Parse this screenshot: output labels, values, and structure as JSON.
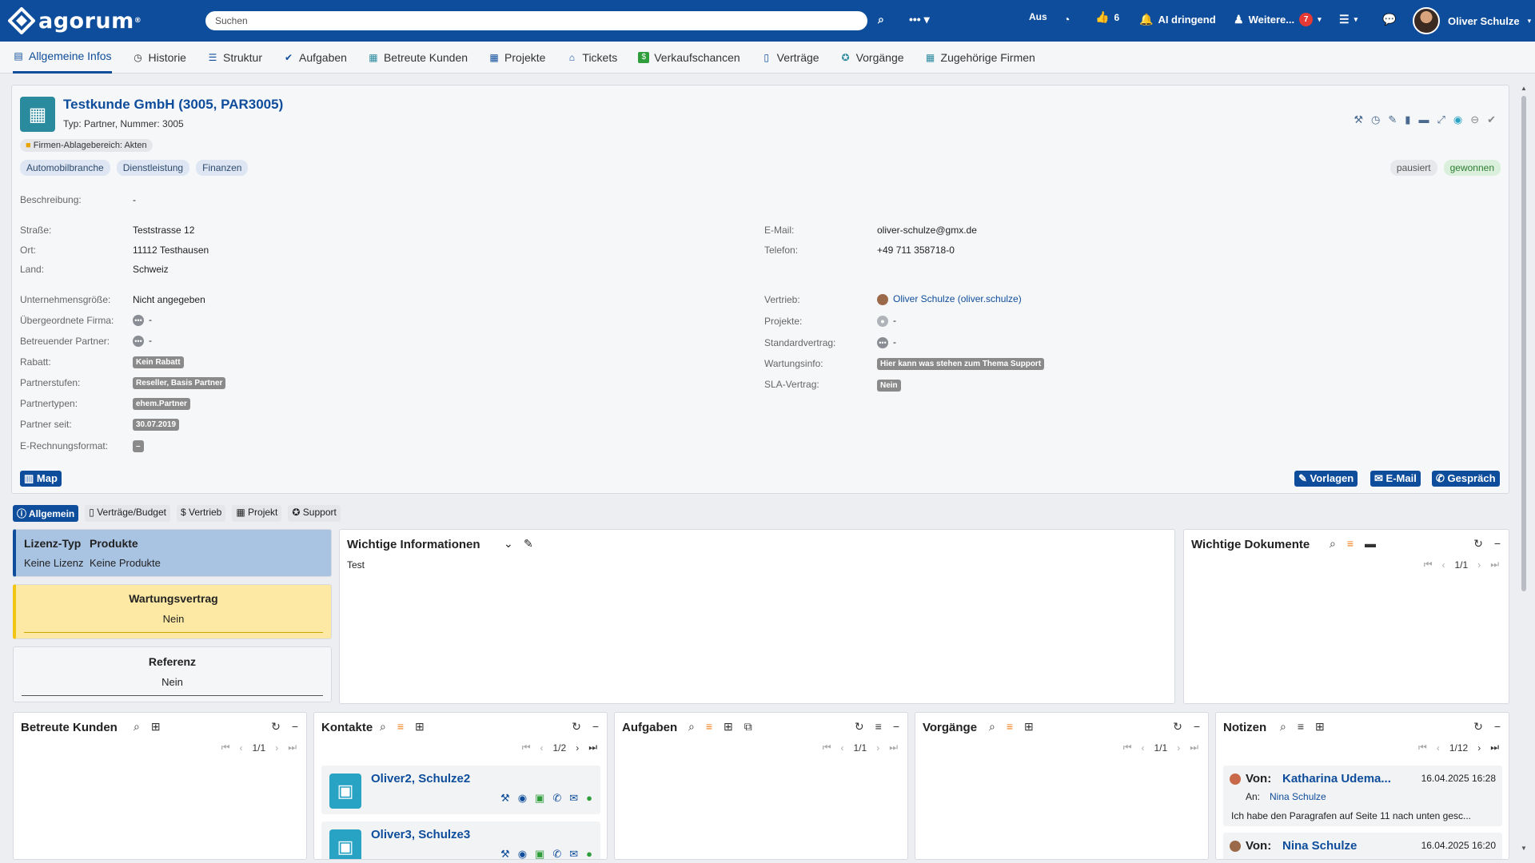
{
  "topbar": {
    "logo": "agorum",
    "search_placeholder": "Suchen",
    "aus": "Aus",
    "likes": "6",
    "ai_label": "AI dringend",
    "more_label": "Weitere...",
    "more_count": "7",
    "user_name": "Oliver Schulze"
  },
  "tabs": [
    {
      "label": "Allgemeine Infos",
      "icon": "list-icon",
      "active": true
    },
    {
      "label": "Historie",
      "icon": "clock-icon"
    },
    {
      "label": "Struktur",
      "icon": "structure-icon"
    },
    {
      "label": "Aufgaben",
      "icon": "check-icon"
    },
    {
      "label": "Betreute Kunden",
      "icon": "building-icon"
    },
    {
      "label": "Projekte",
      "icon": "grid-icon"
    },
    {
      "label": "Tickets",
      "icon": "ticket-icon"
    },
    {
      "label": "Verkaufschancen",
      "icon": "dollar-icon"
    },
    {
      "label": "Verträge",
      "icon": "document-icon"
    },
    {
      "label": "Vorgänge",
      "icon": "process-icon"
    },
    {
      "label": "Zugehörige Firmen",
      "icon": "company-icon"
    }
  ],
  "company": {
    "title": "Testkunde GmbH (3005, PAR3005)",
    "subtitle": "Typ: Partner, Nummer: 3005",
    "ablage": "Firmen-Ablagebereich: Akten",
    "tags": [
      "Automobilbranche",
      "Dienstleistung",
      "Finanzen"
    ],
    "status_paused": "pausiert",
    "status_won": "gewonnen"
  },
  "fields_left": {
    "beschreibung_label": "Beschreibung:",
    "beschreibung": "-",
    "strasse_label": "Straße:",
    "strasse": "Teststrasse 12",
    "ort_label": "Ort:",
    "ort": "11112 Testhausen",
    "land_label": "Land:",
    "land": "Schweiz",
    "groesse_label": "Unternehmensgröße:",
    "groesse": "Nicht angegeben",
    "uebergeordnet_label": "Übergeordnete Firma:",
    "uebergeordnet": "-",
    "partner_label": "Betreuender Partner:",
    "partner": "-",
    "rabatt_label": "Rabatt:",
    "rabatt": "Kein Rabatt",
    "partnerstufen_label": "Partnerstufen:",
    "partnerstufen": "Reseller, Basis Partner",
    "partnertypen_label": "Partnertypen:",
    "partnertypen": "ehem.Partner",
    "partner_seit_label": "Partner seit:",
    "partner_seit": "30.07.2019",
    "erechnung_label": "E-Rechnungsformat:",
    "erechnung": "–"
  },
  "fields_right": {
    "email_label": "E-Mail:",
    "email": "oliver-schulze@gmx.de",
    "telefon_label": "Telefon:",
    "telefon": "+49 711 358718-0",
    "vertrieb_label": "Vertrieb:",
    "vertrieb": "Oliver Schulze (oliver.schulze)",
    "projekte_label": "Projekte:",
    "projekte": "-",
    "standard_label": "Standardvertrag:",
    "standard": "-",
    "wartung_label": "Wartungsinfo:",
    "wartung": "Hier kann was stehen zum Thema Support",
    "sla_label": "SLA-Vertrag:",
    "sla": "Nein"
  },
  "buttons": {
    "map": "Map",
    "vorlagen": "Vorlagen",
    "email": "E-Mail",
    "gespraech": "Gespräch"
  },
  "subtabs": [
    "Allgemein",
    "Verträge/Budget",
    "Vertrieb",
    "Projekt",
    "Support"
  ],
  "lizenz": {
    "typ_label": "Lizenz-Typ",
    "produkte_label": "Produkte",
    "typ": "Keine Lizenz",
    "produkte": "Keine Produkte"
  },
  "wartungsvertrag": {
    "label": "Wartungsvertrag",
    "value": "Nein"
  },
  "referenz": {
    "label": "Referenz",
    "value": "Nein"
  },
  "wichtige_info": {
    "title": "Wichtige Informationen",
    "text": "Test"
  },
  "wichtige_dok": {
    "title": "Wichtige Dokumente",
    "pager": "1/1"
  },
  "betreute": {
    "title": "Betreute Kunden",
    "pager": "1/1"
  },
  "kontakte": {
    "title": "Kontakte",
    "pager": "1/2",
    "items": [
      {
        "name": "Oliver2, Schulze2"
      },
      {
        "name": "Oliver3, Schulze3"
      }
    ]
  },
  "aufgaben": {
    "title": "Aufgaben",
    "pager": "1/1"
  },
  "vorgaenge": {
    "title": "Vorgänge",
    "pager": "1/1"
  },
  "notizen": {
    "title": "Notizen",
    "pager": "1/12",
    "items": [
      {
        "von_label": "Von:",
        "von": "Katharina Udema...",
        "date": "16.04.2025 16:28",
        "an_label": "An:",
        "an": "Nina Schulze",
        "text": "Ich habe den Paragrafen auf Seite 11 nach unten gesc..."
      },
      {
        "von_label": "Von:",
        "von": "Nina Schulze",
        "date": "16.04.2025 16:20"
      }
    ]
  }
}
